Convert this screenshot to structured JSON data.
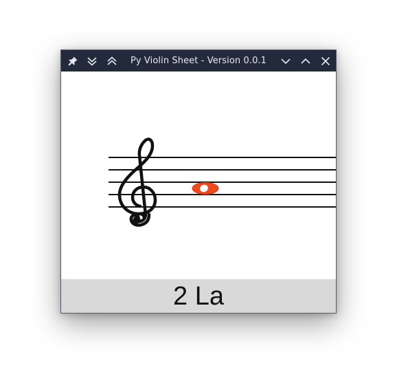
{
  "window": {
    "title": "Py Violin Sheet - Version 0.0.1"
  },
  "titlebar_icons": {
    "left": [
      "pin-icon",
      "keep-below-icon",
      "keep-above-icon"
    ],
    "right": [
      "minimize-icon",
      "maximize-icon",
      "close-icon"
    ]
  },
  "staff": {
    "clef": "treble-clef",
    "note_color": "#ef4a1e"
  },
  "note": {
    "label": "2 La"
  },
  "colors": {
    "titlebar": "#232a3b",
    "footer": "#d9d9d9",
    "note": "#ef4a1e"
  }
}
